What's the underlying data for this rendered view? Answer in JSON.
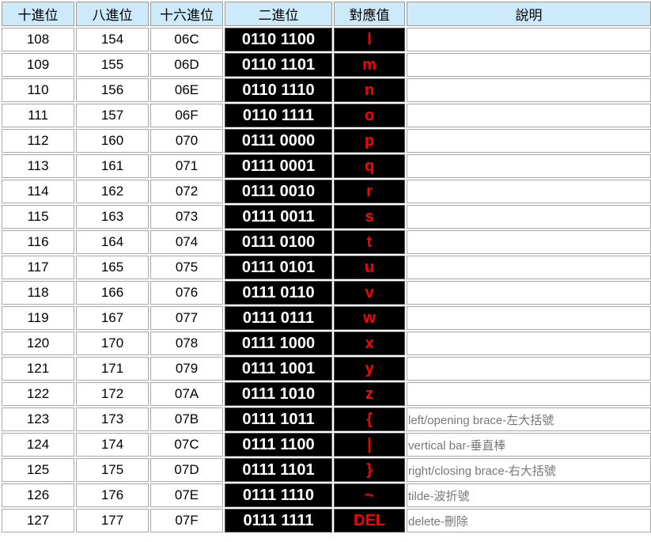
{
  "headers": [
    "十進位",
    "八進位",
    "十六進位",
    "二進位",
    "對應值",
    "說明"
  ],
  "rows": [
    {
      "dec": "108",
      "oct": "154",
      "hex": "06C",
      "bin": "0110 1100",
      "char": "l",
      "desc": ""
    },
    {
      "dec": "109",
      "oct": "155",
      "hex": "06D",
      "bin": "0110 1101",
      "char": "m",
      "desc": ""
    },
    {
      "dec": "110",
      "oct": "156",
      "hex": "06E",
      "bin": "0110 1110",
      "char": "n",
      "desc": ""
    },
    {
      "dec": "111",
      "oct": "157",
      "hex": "06F",
      "bin": "0110 1111",
      "char": "o",
      "desc": ""
    },
    {
      "dec": "112",
      "oct": "160",
      "hex": "070",
      "bin": "0111 0000",
      "char": "p",
      "desc": ""
    },
    {
      "dec": "113",
      "oct": "161",
      "hex": "071",
      "bin": "0111 0001",
      "char": "q",
      "desc": ""
    },
    {
      "dec": "114",
      "oct": "162",
      "hex": "072",
      "bin": "0111 0010",
      "char": "r",
      "desc": ""
    },
    {
      "dec": "115",
      "oct": "163",
      "hex": "073",
      "bin": "0111 0011",
      "char": "s",
      "desc": ""
    },
    {
      "dec": "116",
      "oct": "164",
      "hex": "074",
      "bin": "0111 0100",
      "char": "t",
      "desc": ""
    },
    {
      "dec": "117",
      "oct": "165",
      "hex": "075",
      "bin": "0111 0101",
      "char": "u",
      "desc": ""
    },
    {
      "dec": "118",
      "oct": "166",
      "hex": "076",
      "bin": "0111 0110",
      "char": "v",
      "desc": ""
    },
    {
      "dec": "119",
      "oct": "167",
      "hex": "077",
      "bin": "0111 0111",
      "char": "w",
      "desc": ""
    },
    {
      "dec": "120",
      "oct": "170",
      "hex": "078",
      "bin": "0111 1000",
      "char": "x",
      "desc": ""
    },
    {
      "dec": "121",
      "oct": "171",
      "hex": "079",
      "bin": "0111 1001",
      "char": "y",
      "desc": ""
    },
    {
      "dec": "122",
      "oct": "172",
      "hex": "07A",
      "bin": "0111 1010",
      "char": "z",
      "desc": ""
    },
    {
      "dec": "123",
      "oct": "173",
      "hex": "07B",
      "bin": "0111 1011",
      "char": "{",
      "desc": "left/opening brace-左大括號"
    },
    {
      "dec": "124",
      "oct": "174",
      "hex": "07C",
      "bin": "0111 1100",
      "char": "|",
      "desc": "vertical bar-垂直棒"
    },
    {
      "dec": "125",
      "oct": "175",
      "hex": "07D",
      "bin": "0111 1101",
      "char": "}",
      "desc": "right/closing brace-右大括號"
    },
    {
      "dec": "126",
      "oct": "176",
      "hex": "07E",
      "bin": "0111 1110",
      "char": "~",
      "desc": "tilde-波折號"
    },
    {
      "dec": "127",
      "oct": "177",
      "hex": "07F",
      "bin": "0111 1111",
      "char": "DEL",
      "desc": "delete-刪除"
    }
  ]
}
